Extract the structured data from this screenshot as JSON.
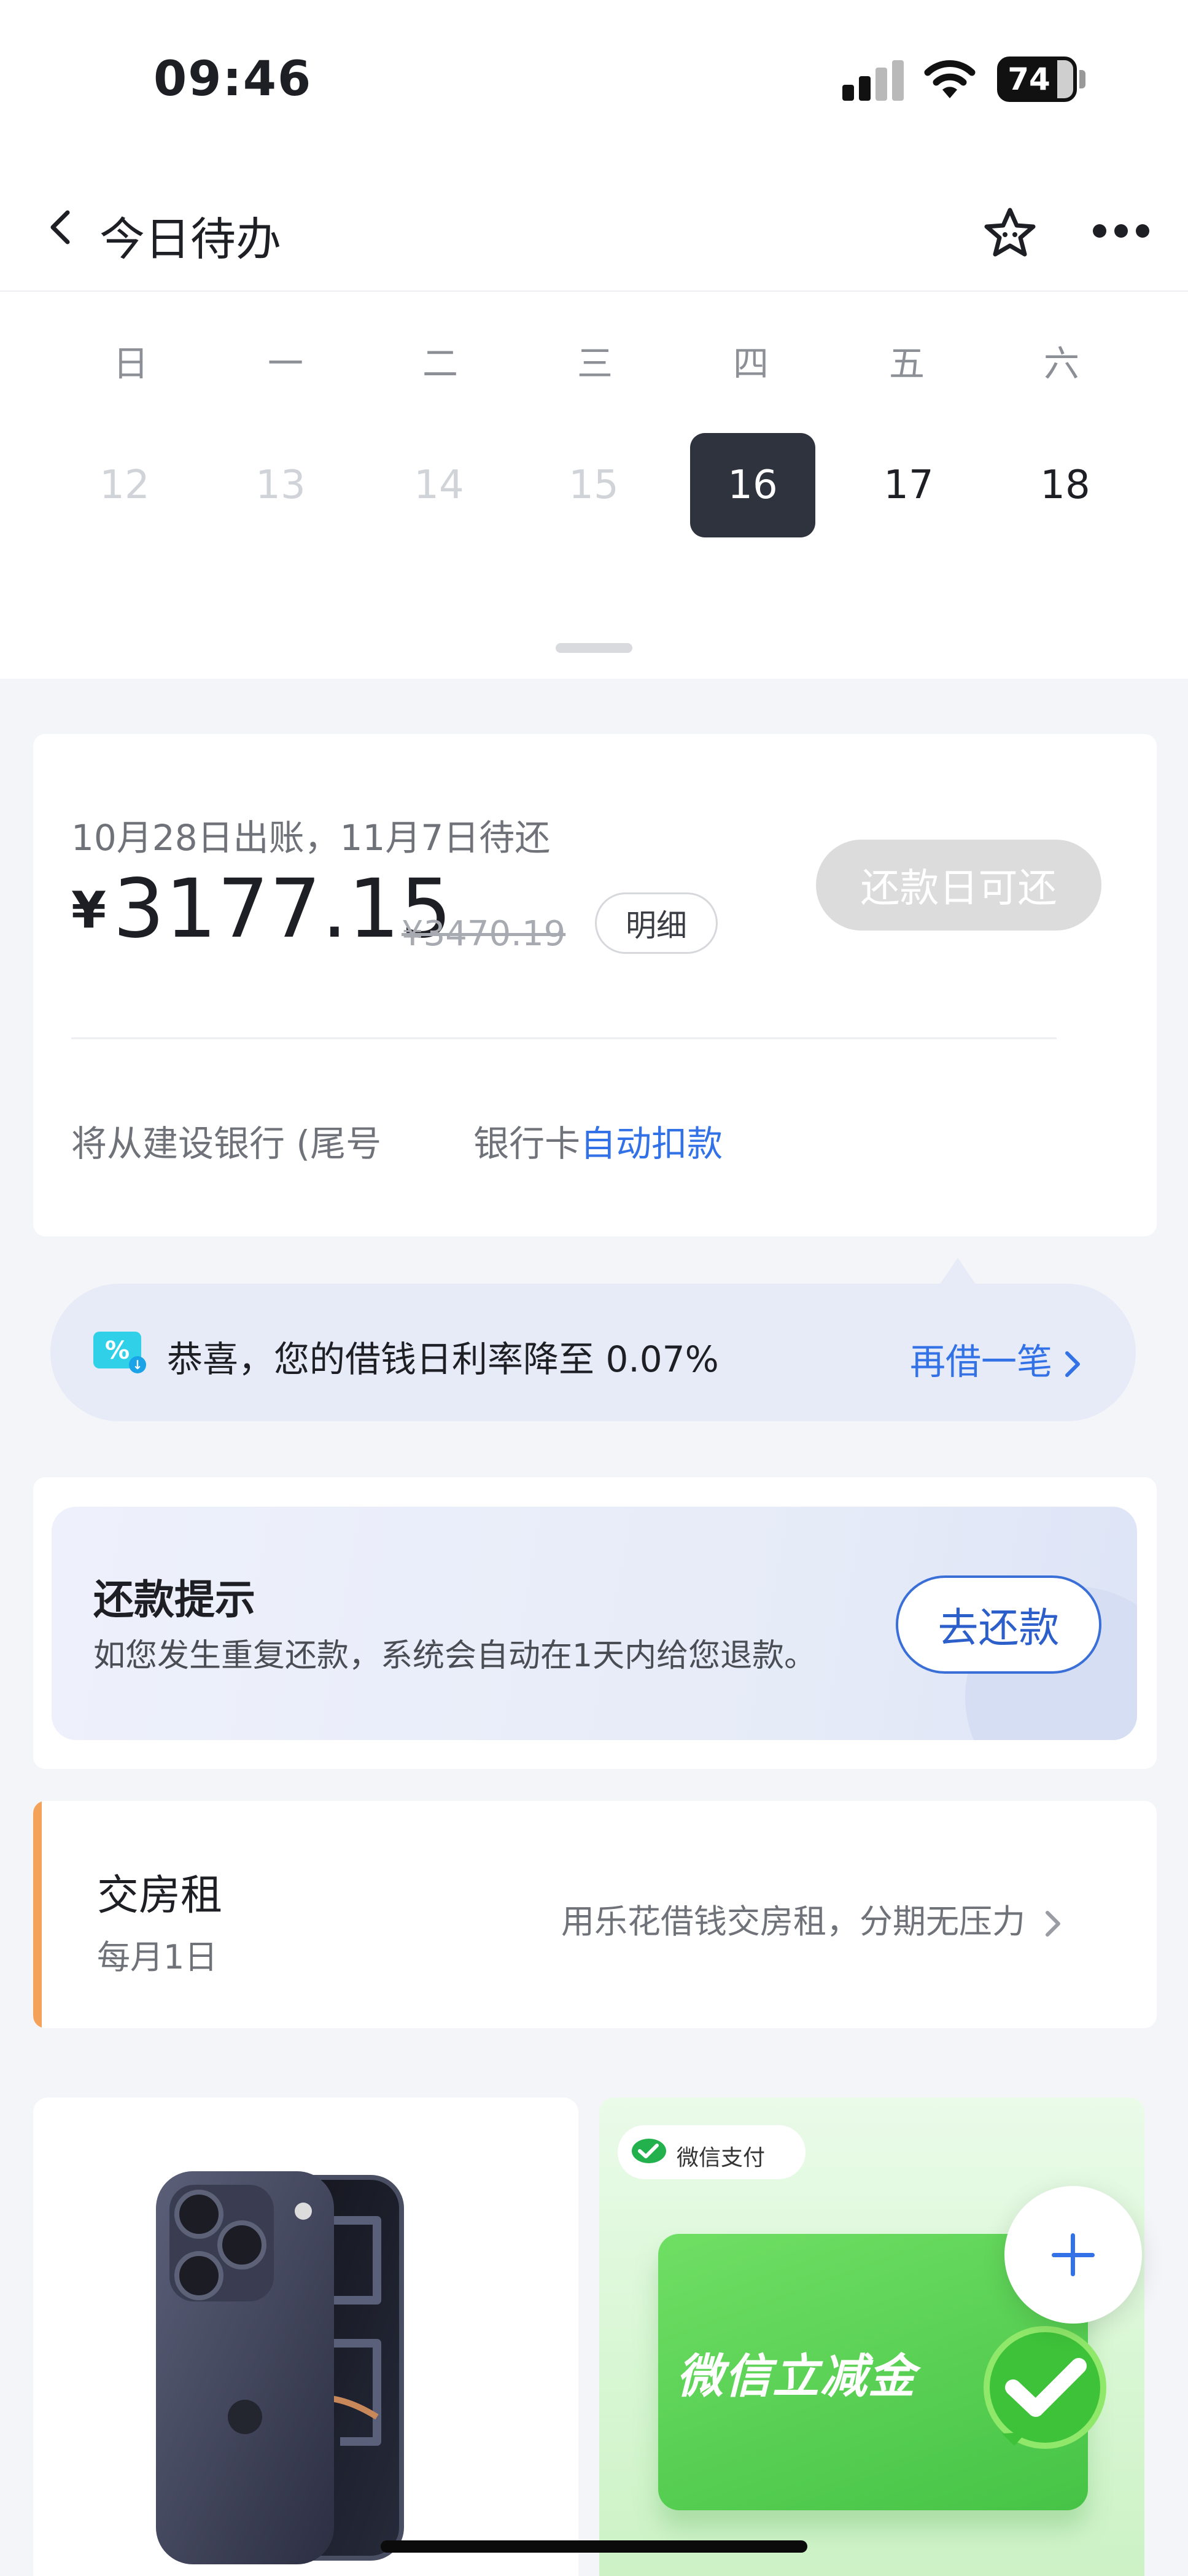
{
  "status_bar": {
    "time": "09:46",
    "battery": "74"
  },
  "nav": {
    "title": "今日待办",
    "back_icon": "chevron-left-icon",
    "favorite_icon": "star-icon",
    "more_icon": "more-dots-icon"
  },
  "calendar": {
    "weekdays": [
      "日",
      "一",
      "二",
      "三",
      "四",
      "五",
      "六"
    ],
    "days": [
      "12",
      "13",
      "14",
      "15",
      "16",
      "17",
      "18"
    ],
    "selected_day": "16"
  },
  "bill": {
    "date_text": "10月28日出账，11月7日待还",
    "currency": "¥",
    "amount": "3177.15",
    "original_amount": "¥3470.19",
    "detail_label": "明细",
    "repay_button": "还款日可还",
    "footer_prefix": "将从建设银行 (尾号",
    "footer_suffix": "银行卡",
    "footer_link": "自动扣款"
  },
  "notice": {
    "icon": "discount-ticket-icon",
    "text": "恭喜，您的借钱日利率降至 0.07%",
    "link": "再借一笔"
  },
  "reminder": {
    "title": "还款提示",
    "desc": "如您发生重复还款，系统会自动在1天内给您退款。",
    "button": "去还款"
  },
  "rent": {
    "title": "交房租",
    "date": "每月1日",
    "hint": "用乐花借钱交房租，分期无压力"
  },
  "promo": {
    "wechat_badge": "微信支付",
    "card_label": "微信立减金"
  },
  "colors": {
    "accent_blue": "#3272e6",
    "selected_day_bg": "#2f333d",
    "rent_bar": "#f4a259",
    "wechat_green": "#46c346"
  }
}
